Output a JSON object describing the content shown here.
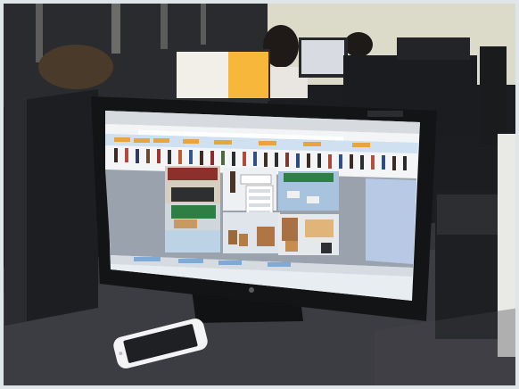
{
  "scene": {
    "description_colors": {
      "ceiling": "#d9d8c8",
      "desk": "#3a3b3e",
      "monitor_bezel": "#141416",
      "screen_bg": "#eef1f5",
      "browser_bar": "#e2e6ea",
      "app_orange": "#f29a2e",
      "app_blue": "#7fb2e2",
      "phone": "#f4f4f6",
      "background_monitor_screen": "#f7b73a"
    }
  },
  "monitor": {
    "brand_label": ""
  },
  "app": {
    "toolbar_buttons": [
      "",
      "",
      "",
      "",
      "",
      "",
      "",
      ""
    ]
  }
}
